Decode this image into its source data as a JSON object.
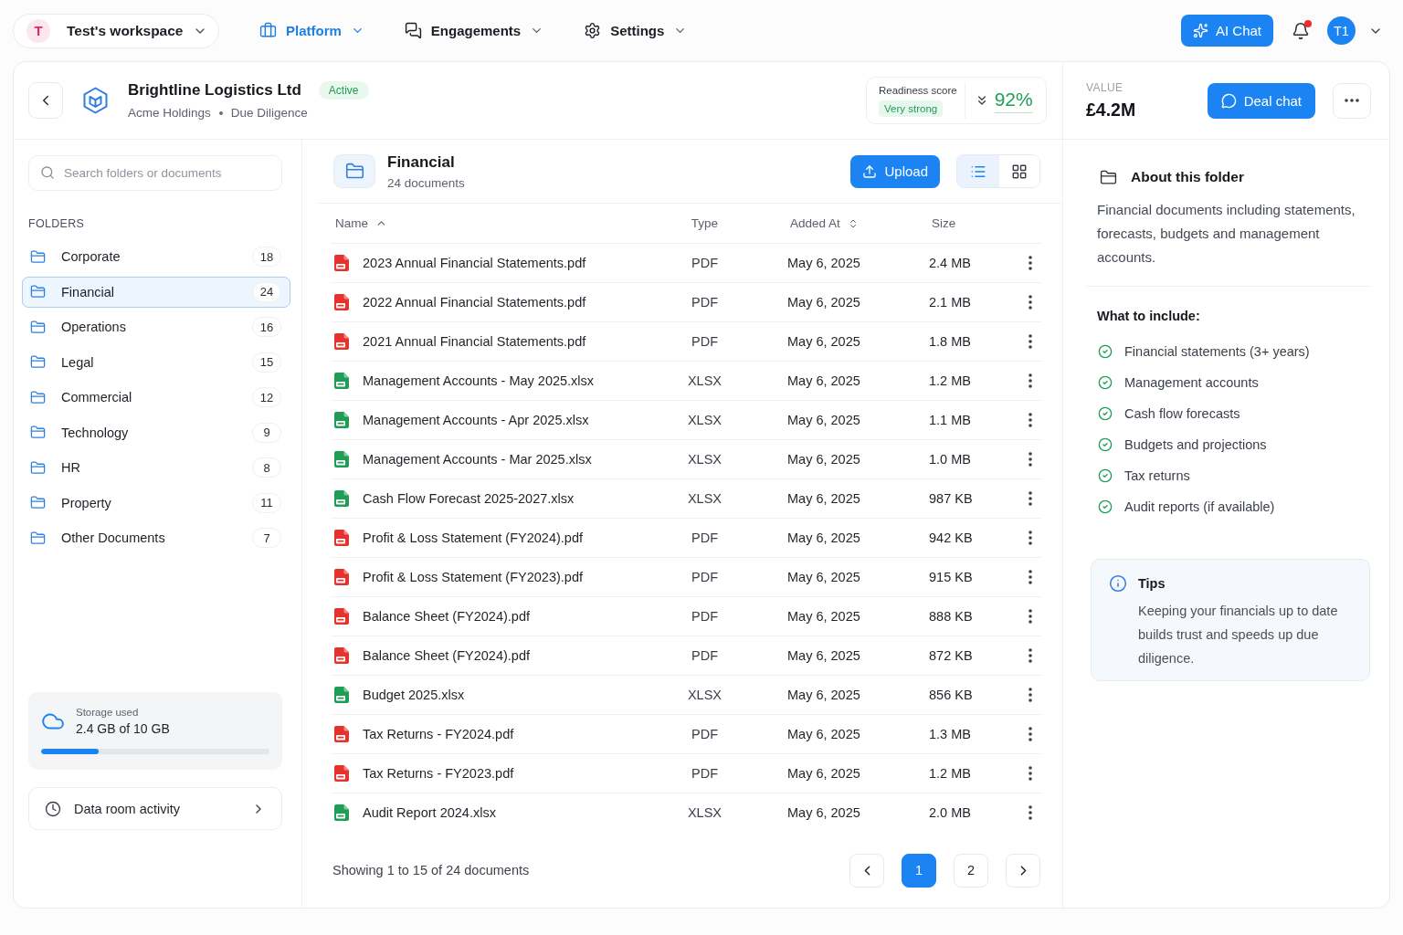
{
  "top_bar": {
    "workspace": {
      "initial": "T",
      "name": "Test's workspace"
    },
    "nav": [
      {
        "label": "Platform",
        "selected": true
      },
      {
        "label": "Engagements",
        "selected": false
      },
      {
        "label": "Settings",
        "selected": false
      }
    ],
    "ai_chat_button": "AI Chat",
    "notifications": {
      "unread": true
    },
    "user": {
      "initials": "T1"
    }
  },
  "deal": {
    "name": "Brightline Logistics Ltd",
    "status": "Active",
    "company": "Acme Holdings",
    "stage": "Due Diligence",
    "readiness": {
      "label": "Readiness score",
      "rating": "Very strong",
      "score": "92%"
    }
  },
  "value_panel": {
    "label": "VALUE",
    "amount": "£4.2M",
    "deal_chat_button": "Deal chat"
  },
  "sidebar": {
    "search": {
      "placeholder": "Search folders or documents"
    },
    "folders_heading": "FOLDERS",
    "folders": [
      {
        "name": "Corporate",
        "count": "18",
        "selected": false
      },
      {
        "name": "Financial",
        "count": "24",
        "selected": true
      },
      {
        "name": "Operations",
        "count": "16",
        "selected": false
      },
      {
        "name": "Legal",
        "count": "15",
        "selected": false
      },
      {
        "name": "Commercial",
        "count": "12",
        "selected": false
      },
      {
        "name": "Technology",
        "count": "9",
        "selected": false
      },
      {
        "name": "HR",
        "count": "8",
        "selected": false
      },
      {
        "name": "Property",
        "count": "11",
        "selected": false
      },
      {
        "name": "Other Documents",
        "count": "7",
        "selected": false
      }
    ],
    "storage": {
      "label": "Storage used",
      "reading": "2.4 GB of 10 GB",
      "level": 0.25
    },
    "activity_link": "Data room activity"
  },
  "folder_view": {
    "title": "Financial",
    "document_count": "24 documents",
    "upload_button": "Upload",
    "view_modes": [
      {
        "kind": "list",
        "selected": true
      },
      {
        "kind": "grid",
        "selected": false
      }
    ]
  },
  "table": {
    "columns": [
      {
        "label": "Name",
        "sortable": true,
        "sorted": true
      },
      {
        "label": "Type",
        "sortable": false,
        "sorted": false
      },
      {
        "label": "Added At",
        "sortable": true,
        "sorted": false
      },
      {
        "label": "Size",
        "sortable": false,
        "sorted": false
      }
    ],
    "rows": [
      {
        "kind": "pdf",
        "name": "2023 Annual Financial Statements.pdf",
        "type": "PDF",
        "added_at": "May 6, 2025",
        "size": "2.4 MB"
      },
      {
        "kind": "pdf",
        "name": "2022 Annual Financial Statements.pdf",
        "type": "PDF",
        "added_at": "May 6, 2025",
        "size": "2.1 MB"
      },
      {
        "kind": "pdf",
        "name": "2021 Annual Financial Statements.pdf",
        "type": "PDF",
        "added_at": "May 6, 2025",
        "size": "1.8 MB"
      },
      {
        "kind": "xlsx",
        "name": "Management Accounts - May 2025.xlsx",
        "type": "XLSX",
        "added_at": "May 6, 2025",
        "size": "1.2 MB"
      },
      {
        "kind": "xlsx",
        "name": "Management Accounts - Apr 2025.xlsx",
        "type": "XLSX",
        "added_at": "May 6, 2025",
        "size": "1.1 MB"
      },
      {
        "kind": "xlsx",
        "name": "Management Accounts - Mar 2025.xlsx",
        "type": "XLSX",
        "added_at": "May 6, 2025",
        "size": "1.0 MB"
      },
      {
        "kind": "xlsx",
        "name": "Cash Flow Forecast 2025-2027.xlsx",
        "type": "XLSX",
        "added_at": "May 6, 2025",
        "size": "987 KB"
      },
      {
        "kind": "pdf",
        "name": "Profit & Loss Statement (FY2024).pdf",
        "type": "PDF",
        "added_at": "May 6, 2025",
        "size": "942 KB"
      },
      {
        "kind": "pdf",
        "name": "Profit & Loss Statement (FY2023).pdf",
        "type": "PDF",
        "added_at": "May 6, 2025",
        "size": "915 KB"
      },
      {
        "kind": "pdf",
        "name": "Balance Sheet (FY2024).pdf",
        "type": "PDF",
        "added_at": "May 6, 2025",
        "size": "888 KB"
      },
      {
        "kind": "pdf",
        "name": "Balance Sheet (FY2024).pdf",
        "type": "PDF",
        "added_at": "May 6, 2025",
        "size": "872 KB"
      },
      {
        "kind": "xlsx",
        "name": "Budget 2025.xlsx",
        "type": "XLSX",
        "added_at": "May 6, 2025",
        "size": "856 KB"
      },
      {
        "kind": "pdf",
        "name": "Tax Returns - FY2024.pdf",
        "type": "PDF",
        "added_at": "May 6, 2025",
        "size": "1.3 MB"
      },
      {
        "kind": "pdf",
        "name": "Tax Returns - FY2023.pdf",
        "type": "PDF",
        "added_at": "May 6, 2025",
        "size": "1.2 MB"
      },
      {
        "kind": "xlsx",
        "name": "Audit Report 2024.xlsx",
        "type": "XLSX",
        "added_at": "May 6, 2025",
        "size": "2.0 MB"
      }
    ]
  },
  "pagination": {
    "summary": "Showing 1 to 15 of 24 documents",
    "pages": [
      {
        "label": "1",
        "selected": true
      },
      {
        "label": "2",
        "selected": false
      }
    ]
  },
  "about": {
    "title": "About this folder",
    "description": "Financial documents including statements, forecasts, budgets and management accounts.",
    "include_heading": "What to include:",
    "checklist": [
      {
        "label": "Financial statements (3+ years)",
        "checked": true
      },
      {
        "label": "Management accounts",
        "checked": true
      },
      {
        "label": "Cash flow forecasts",
        "checked": true
      },
      {
        "label": "Budgets and projections",
        "checked": true
      },
      {
        "label": "Tax returns",
        "checked": true
      },
      {
        "label": "Audit reports (if available)",
        "checked": true
      }
    ],
    "tips": {
      "title": "Tips",
      "text": "Keeping your financials up to date builds trust and speeds up due diligence."
    }
  }
}
